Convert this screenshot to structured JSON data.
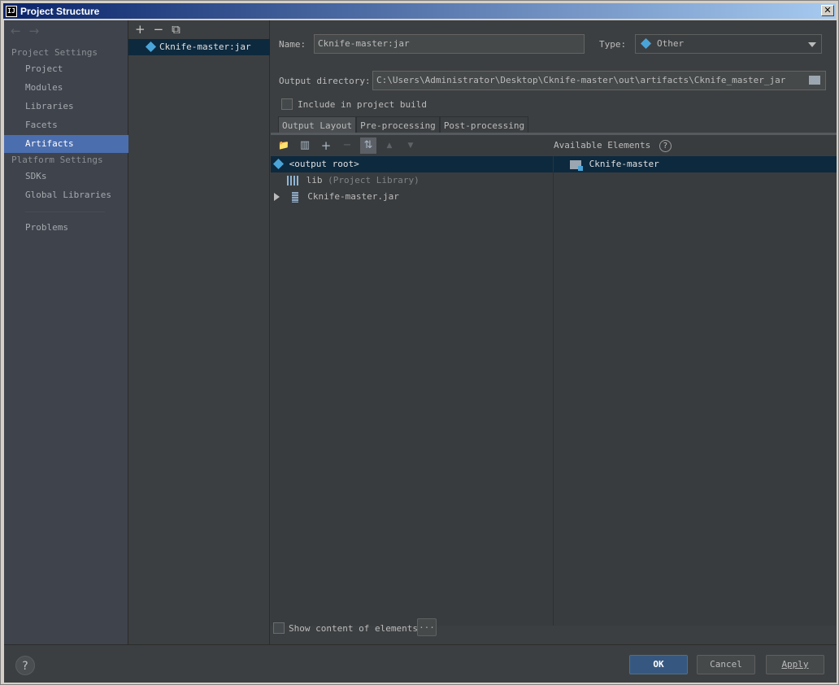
{
  "window": {
    "title": "Project Structure",
    "app_icon_text": "IJ",
    "close_glyph": "✕"
  },
  "nav": {
    "back": "←",
    "forward": "→"
  },
  "sidebar": {
    "project_settings_heading": "Project Settings",
    "project_items": [
      {
        "label": "Project"
      },
      {
        "label": "Modules"
      },
      {
        "label": "Libraries"
      },
      {
        "label": "Facets"
      },
      {
        "label": "Artifacts",
        "active": true
      }
    ],
    "platform_settings_heading": "Platform Settings",
    "platform_items": [
      {
        "label": "SDKs"
      },
      {
        "label": "Global Libraries"
      }
    ],
    "problems": "Problems"
  },
  "artifact_list": {
    "toolbar": {
      "add": "+",
      "remove": "−",
      "copy": "⧉"
    },
    "items": [
      {
        "label": "Cknife-master:jar"
      }
    ]
  },
  "artifact": {
    "name_label": "Name:",
    "name_value": "Cknife-master:jar",
    "type_label": "Type:",
    "type_value": "Other",
    "output_dir_label": "Output directory:",
    "output_dir_value": "C:\\Users\\Administrator\\Desktop\\Cknife-master\\out\\artifacts\\Cknife_master_jar",
    "include_build_label": "Include in project build",
    "include_build_checked": false
  },
  "tabs": [
    {
      "label": "Output Layout",
      "active": true
    },
    {
      "label": "Pre-processing"
    },
    {
      "label": "Post-processing"
    }
  ],
  "layout_toolbar": {
    "new_dir": "📁",
    "add_archive": "▥",
    "add": "+",
    "remove": "−",
    "sort": "⇅",
    "up": "▲",
    "down": "▼"
  },
  "available_elements": {
    "heading": "Available Elements",
    "help": "?",
    "items": [
      {
        "label": "Cknife-master"
      }
    ]
  },
  "tree": {
    "root": "<output root>",
    "lib_name": "lib",
    "lib_note": "(Project Library)",
    "jar_name": "Cknife-master.jar"
  },
  "show_content": {
    "label": "Show content of elements",
    "more": "..."
  },
  "footer": {
    "help": "?",
    "ok": "OK",
    "cancel": "Cancel",
    "apply": "Apply"
  }
}
